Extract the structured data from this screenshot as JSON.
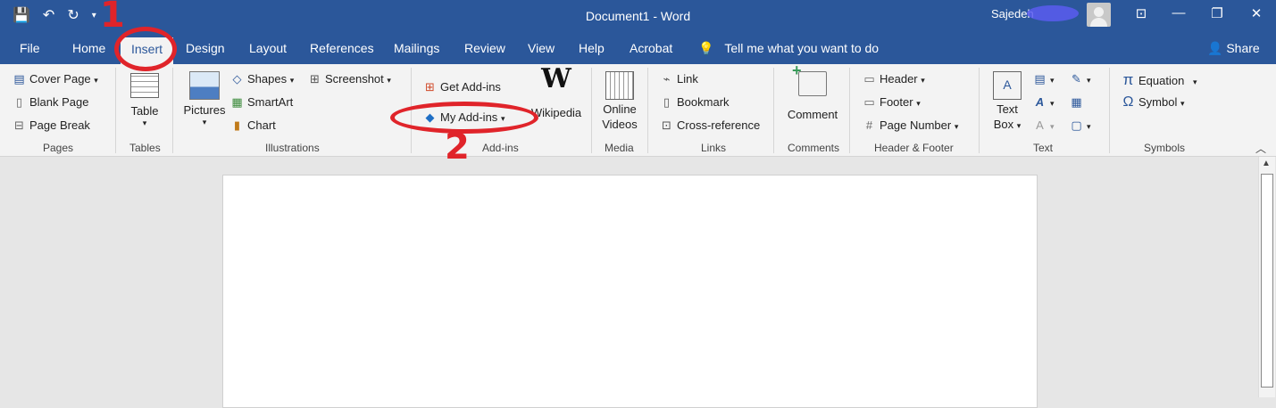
{
  "window": {
    "title": "Document1  -  Word",
    "user": "Sajedeh"
  },
  "tabs": [
    "File",
    "Home",
    "Insert",
    "Design",
    "Layout",
    "References",
    "Mailings",
    "Review",
    "View",
    "Help",
    "Acrobat"
  ],
  "tell_me": "Tell me what you want to do",
  "share": "Share",
  "ribbon": {
    "pages": {
      "cover_page": "Cover Page",
      "blank_page": "Blank Page",
      "page_break": "Page Break",
      "label": "Pages"
    },
    "tables": {
      "table": "Table",
      "label": "Tables"
    },
    "illustrations": {
      "pictures": "Pictures",
      "shapes": "Shapes",
      "smartart": "SmartArt",
      "chart": "Chart",
      "screenshot": "Screenshot",
      "label": "Illustrations"
    },
    "addins": {
      "get": "Get Add-ins",
      "my": "My Add-ins",
      "wikipedia": "Wikipedia",
      "label": "Add-ins"
    },
    "media": {
      "online": "Online",
      "videos": "Videos",
      "label": "Media"
    },
    "links": {
      "link": "Link",
      "bookmark": "Bookmark",
      "crossref": "Cross-reference",
      "label": "Links"
    },
    "comments": {
      "comment": "Comment",
      "label": "Comments"
    },
    "header_footer": {
      "header": "Header",
      "footer": "Footer",
      "page_number": "Page Number",
      "label": "Header & Footer"
    },
    "text": {
      "text": "Text",
      "box": "Box",
      "label": "Text"
    },
    "symbols": {
      "equation": "Equation",
      "symbol": "Symbol",
      "label": "Symbols"
    }
  },
  "annotations": {
    "one": "1",
    "two": "2"
  },
  "accent_color": "#2b579a",
  "annotation_color": "#e0242a"
}
